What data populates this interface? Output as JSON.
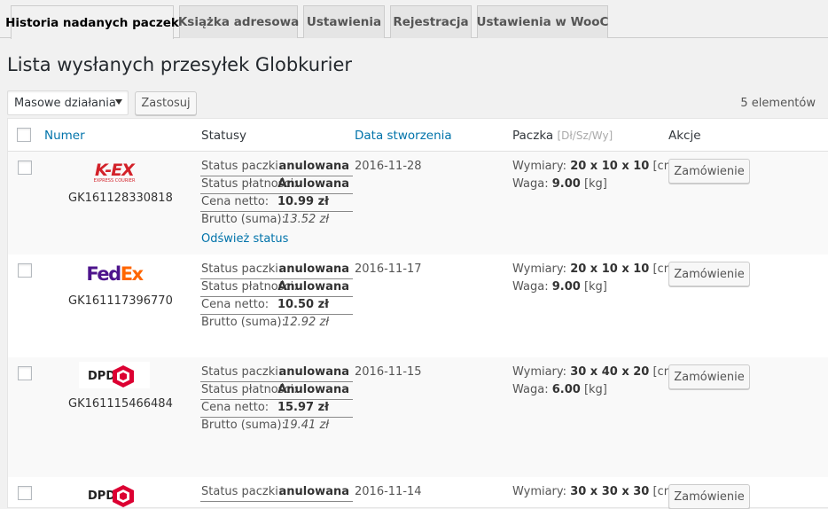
{
  "tabs": [
    {
      "label": "Historia nadanych paczek",
      "active": true
    },
    {
      "label": "Książka adresowa"
    },
    {
      "label": "Ustawienia"
    },
    {
      "label": "Rejestracja"
    },
    {
      "label": "Ustawienia w WooC"
    }
  ],
  "page_title": "Lista wysłanych przesyłek Globkurier",
  "bulk": {
    "selected": "Masowe działania",
    "apply_label": "Zastosuj"
  },
  "items_count": "5 elementów",
  "columns": {
    "number": "Numer",
    "statuses": "Statusy",
    "created": "Data stworzenia",
    "package": "Paczka",
    "package_hint": "[Dł/Sz/Wy]",
    "actions": "Akcje"
  },
  "labels": {
    "package_status": "Status paczki:",
    "payment_status": "Status płatności:",
    "net_price": "Cena netto:",
    "gross": "Brutto (suma):",
    "refresh": "Odśwież status",
    "dimensions": "Wymiary:",
    "weight": "Waga:",
    "order_button": "Zamówienie"
  },
  "shipments": [
    {
      "carrier": "K-EX",
      "carrier_tagline": "EXPRESS COURIER",
      "tracking": "GK161128330818",
      "package_status": "anulowana",
      "payment_status": "Anulowana",
      "net": "10.99 zł",
      "gross": "13.52 zł",
      "date": "2016-11-28",
      "dims": "20 x 10 x 10",
      "dims_unit": "[cm]",
      "weight": "9.00",
      "weight_unit": "[kg]",
      "refresh": true
    },
    {
      "carrier": "FedEx",
      "tracking": "GK161117396770",
      "package_status": "anulowana",
      "payment_status": "Anulowana",
      "net": "10.50 zł",
      "gross": "12.92 zł",
      "date": "2016-11-17",
      "dims": "20 x 10 x 10",
      "dims_unit": "[cm]",
      "weight": "9.00",
      "weight_unit": "[kg]"
    },
    {
      "carrier": "DPD",
      "tracking": "GK161115466484",
      "package_status": "anulowana",
      "payment_status": "Anulowana",
      "net": "15.97 zł",
      "gross": "19.41 zł",
      "date": "2016-11-15",
      "dims": "30 x 40 x 20",
      "dims_unit": "[cm]",
      "weight": "6.00",
      "weight_unit": "[kg]"
    },
    {
      "carrier": "DPD",
      "package_status": "anulowana",
      "date": "2016-11-14",
      "dims": "30 x 30 x 30",
      "dims_unit": "[cm]"
    }
  ],
  "colors": {
    "link": "#0073aa",
    "kex_red": "#d3222a",
    "fedex_purple": "#4d148c",
    "fedex_orange": "#ff6600",
    "dpd_red": "#dc0032"
  }
}
